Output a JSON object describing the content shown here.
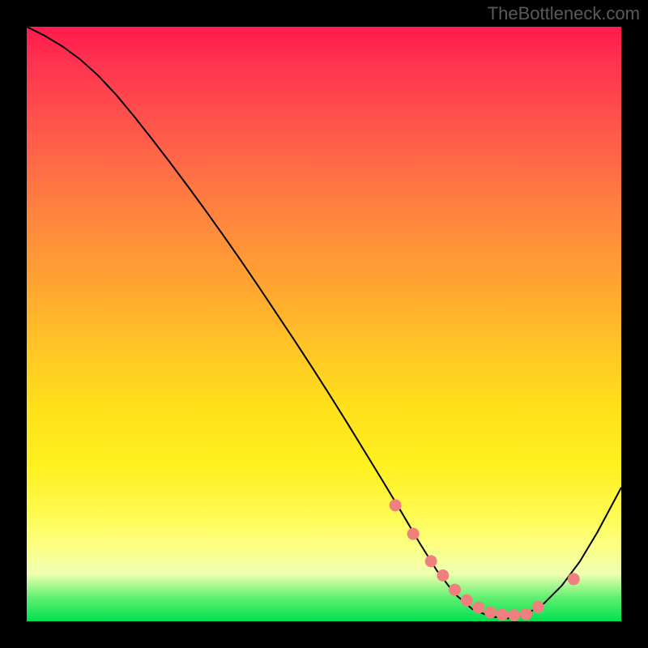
{
  "watermark": "TheBottleneck.com",
  "chart_data": {
    "type": "line",
    "title": "",
    "xlabel": "",
    "ylabel": "",
    "xlim": [
      0,
      100
    ],
    "ylim": [
      0,
      100
    ],
    "grid": false,
    "series": [
      {
        "name": "curve",
        "x": [
          0,
          3,
          6,
          9,
          12,
          15,
          18,
          21,
          24,
          27,
          30,
          33,
          36,
          39,
          42,
          45,
          48,
          51,
          54,
          57,
          60,
          63,
          66,
          69,
          72,
          75,
          78,
          81,
          84,
          87,
          90,
          93,
          96,
          100
        ],
        "values": [
          100,
          98.5,
          96.7,
          94.5,
          91.8,
          88.6,
          85.0,
          81.2,
          77.3,
          73.3,
          69.2,
          65.0,
          60.7,
          56.3,
          51.8,
          47.3,
          42.7,
          38.0,
          33.2,
          28.3,
          23.4,
          18.4,
          13.3,
          8.5,
          4.6,
          2.0,
          0.8,
          0.5,
          1.2,
          3.0,
          6.0,
          10.0,
          15.0,
          22.5
        ]
      },
      {
        "name": "markers",
        "x": [
          62,
          65,
          68,
          70,
          72,
          74,
          76,
          78,
          80,
          82,
          84,
          86,
          92
        ],
        "values": [
          19.5,
          14.7,
          10.1,
          7.7,
          5.3,
          3.5,
          2.3,
          1.5,
          1.1,
          1.0,
          1.2,
          2.4,
          7.1
        ],
        "style": "points"
      }
    ],
    "colors": {
      "curve_stroke": "#000000",
      "marker": "#f08080"
    }
  }
}
